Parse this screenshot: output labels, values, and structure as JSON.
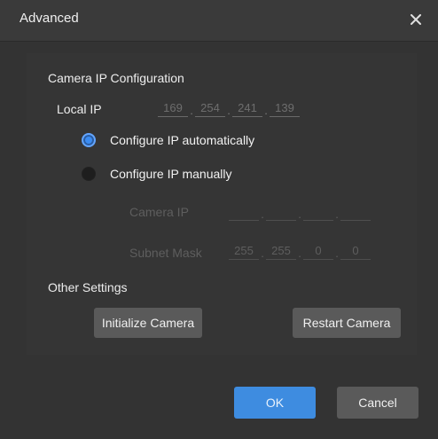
{
  "dialog": {
    "title": "Advanced",
    "close_icon": "close-icon"
  },
  "camera_ip_config": {
    "heading": "Camera IP Configuration",
    "local_ip_label": "Local IP",
    "local_ip": [
      "169",
      "254",
      "241",
      "139"
    ],
    "auto_label": "Configure IP automatically",
    "manual_label": "Configure IP manually",
    "selected_mode": "auto",
    "camera_ip_label": "Camera IP",
    "camera_ip": [
      "",
      "",
      "",
      ""
    ],
    "subnet_mask_label": "Subnet Mask",
    "subnet_mask": [
      "255",
      "255",
      "0",
      "0"
    ]
  },
  "other_settings": {
    "heading": "Other Settings",
    "initialize_label": "Initialize Camera",
    "restart_label": "Restart Camera"
  },
  "footer": {
    "ok_label": "OK",
    "cancel_label": "Cancel"
  },
  "colors": {
    "accent": "#3e8ce0",
    "background": "#333333"
  }
}
